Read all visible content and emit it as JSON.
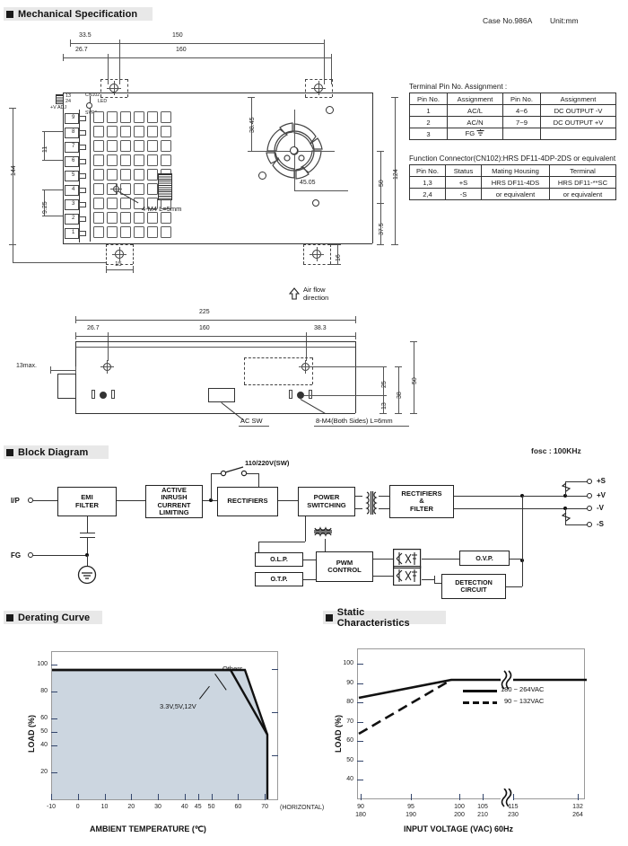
{
  "page": {
    "sections": {
      "mechanical": "Mechanical Specification",
      "block": "Block Diagram",
      "derating": "Derating Curve",
      "static": "Static Characteristics"
    },
    "case_no": "Case No.986A",
    "unit": "Unit:mm",
    "fosc": "fosc : 100KHz"
  },
  "mechanical": {
    "top_view": {
      "dims": {
        "d33_5": "33.5",
        "d150": "150",
        "d26_7": "26.7",
        "d160": "160",
        "d144": "144",
        "d11": "11",
        "d9_25": "9.25",
        "d38_45": "38.45",
        "d45_05": "45.05",
        "d50": "50",
        "d124": "124",
        "d37_5": "37.5",
        "d15": "15",
        "d16": "16"
      },
      "labels": {
        "cn102": "CN102",
        "led": "LED",
        "vadj": "+V ADJ",
        "svr1": "SVR1",
        "pin13": "13",
        "pin24": "24",
        "screws": "4-M4 L=5mm"
      },
      "terminal_pins": [
        "9",
        "8",
        "7",
        "6",
        "5",
        "4",
        "3",
        "2",
        "1"
      ]
    },
    "side_view": {
      "airflow": [
        "Air flow",
        "direction"
      ],
      "dims": {
        "d225": "225",
        "d26_7": "26.7",
        "d160": "160",
        "d38_3": "38.3",
        "d13max": "13max.",
        "d25": "25",
        "d13": "13",
        "d38": "38",
        "d50": "50"
      },
      "labels": {
        "ac_sw": "AC SW",
        "screws": "8-M4(Both Sides) L=6mm"
      }
    },
    "terminal_table": {
      "caption": "Terminal Pin No. Assignment :",
      "headers": [
        "Pin No.",
        "Assignment",
        "Pin No.",
        "Assignment"
      ],
      "rows": [
        [
          "1",
          "AC/L",
          "4~6",
          "DC OUTPUT -V"
        ],
        [
          "2",
          "AC/N",
          "7~9",
          "DC OUTPUT +V"
        ],
        [
          "3",
          "FG",
          "",
          ""
        ]
      ]
    },
    "function_table": {
      "caption": "Function Connector(CN102):HRS DF11-4DP-2DS or equivalent",
      "headers": [
        "Pin No.",
        "Status",
        "Mating Housing",
        "Terminal"
      ],
      "rows": [
        [
          "1,3",
          "+S",
          "HRS DF11-4DS",
          "HRS DF11-**SC"
        ],
        [
          "2,4",
          "-S",
          "or equivalent",
          "or equivalent"
        ]
      ]
    }
  },
  "block_diagram": {
    "terminals_in": [
      {
        "name": "I/P",
        "label": "I/P"
      },
      {
        "name": "FG",
        "label": "FG"
      }
    ],
    "terminals_out": [
      {
        "label": "+S"
      },
      {
        "label": "+V"
      },
      {
        "label": "-V"
      },
      {
        "label": "-S"
      }
    ],
    "switch_label": "110/220V(SW)",
    "blocks": {
      "emi": "EMI<br>FILTER",
      "inrush": "ACTIVE<br>INRUSH<br>CURRENT<br>LIMITING",
      "rect1": "RECTIFIERS",
      "power": "POWER<br>SWITCHING",
      "rect2": "RECTIFIERS<br>&amp;<br>FILTER",
      "olp": "O.L.P.",
      "otp": "O.T.P.",
      "pwm": "PWM<br>CONTROL",
      "ovp": "O.V.P.",
      "detection": "DETECTION<br>CIRCUIT"
    }
  },
  "chart_data": [
    {
      "type": "line",
      "name": "derating-curve",
      "title": "Derating Curve",
      "xlabel": "AMBIENT TEMPERATURE (℃)",
      "ylabel": "LOAD (%)",
      "xlim": [
        -10,
        75
      ],
      "ylim": [
        0,
        110
      ],
      "xticks": [
        -10,
        0,
        10,
        20,
        30,
        40,
        45,
        50,
        60,
        70
      ],
      "xticklabels": [
        "-10",
        "0",
        "10",
        "20",
        "30",
        "40",
        "45",
        "50",
        "60",
        "70"
      ],
      "yticks": [
        20,
        40,
        50,
        60,
        80,
        100
      ],
      "yticklabels": [
        "20",
        "40",
        "50",
        "60",
        "80",
        "100"
      ],
      "grid": false,
      "annotations": [
        "(HORIZONTAL)"
      ],
      "series": [
        {
          "name": "3.3V,5V,12V",
          "label": "3.3V,5V,12V",
          "style": "solid",
          "points": [
            [
              -10,
              100
            ],
            [
              45,
              100
            ],
            [
              60,
              50
            ],
            [
              60,
              0
            ]
          ]
        },
        {
          "name": "Others",
          "label": "Others",
          "style": "solid",
          "points": [
            [
              -10,
              100
            ],
            [
              50,
              100
            ],
            [
              60,
              60
            ],
            [
              60,
              0
            ]
          ]
        }
      ]
    },
    {
      "type": "line",
      "name": "static-characteristics",
      "title": "Static Characteristics",
      "xlabel": "INPUT VOLTAGE (VAC) 60Hz",
      "ylabel": "LOAD (%)",
      "xlim": [
        88,
        134
      ],
      "ylim": [
        30,
        108
      ],
      "xticklabels_top": [
        "90",
        "95",
        "100",
        "105",
        "115",
        "132"
      ],
      "xticklabels_bottom": [
        "180",
        "190",
        "200",
        "210",
        "230",
        "264"
      ],
      "yticks": [
        40,
        50,
        60,
        70,
        80,
        90,
        100
      ],
      "yticklabels": [
        "40",
        "50",
        "60",
        "70",
        "80",
        "90",
        "100"
      ],
      "grid": false,
      "axis_break": true,
      "legend_position": "center",
      "series": [
        {
          "name": "180 ~ 264VAC",
          "label": "180 ~ 264VAC",
          "style": "solid",
          "points": [
            [
              90,
              90
            ],
            [
              105,
              100
            ],
            [
              132,
              100
            ]
          ]
        },
        {
          "name": "90 ~ 132VAC",
          "label": "90 ~ 132VAC",
          "style": "dashed",
          "points": [
            [
              90,
              70
            ],
            [
              105,
              100
            ],
            [
              132,
              100
            ]
          ]
        }
      ]
    }
  ]
}
